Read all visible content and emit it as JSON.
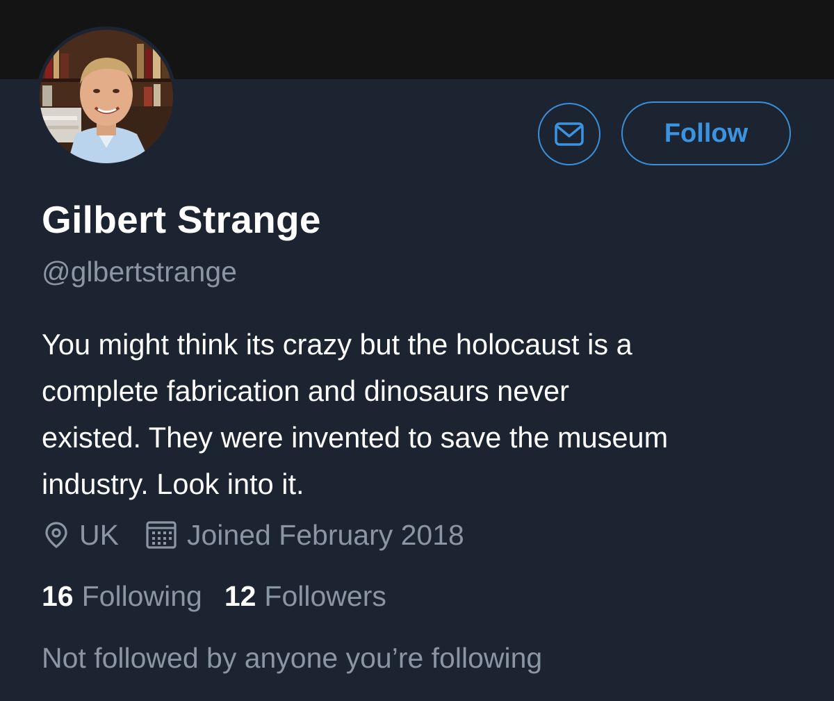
{
  "profile": {
    "display_name": "Gilbert Strange",
    "handle": "@glbertstrange",
    "bio": "You might think its crazy but the holocaust is a\ncomplete fabrication and dinosaurs never\nexisted. They were invented to save the museum\nindustry. Look into it.",
    "location": "UK",
    "joined": "Joined February 2018",
    "following_count": "16",
    "following_label": "Following",
    "followers_count": "12",
    "followers_label": "Followers",
    "not_followed_note": "Not followed by anyone you’re following"
  },
  "actions": {
    "follow_label": "Follow",
    "message_icon": "envelope-icon"
  },
  "icons": {
    "location": "location-pin-icon",
    "calendar": "calendar-icon"
  },
  "colors": {
    "background": "#1c2431",
    "banner": "#141414",
    "accent": "#3b94e2",
    "secondary_text": "#8a96a3",
    "primary_text": "#ffffff"
  }
}
